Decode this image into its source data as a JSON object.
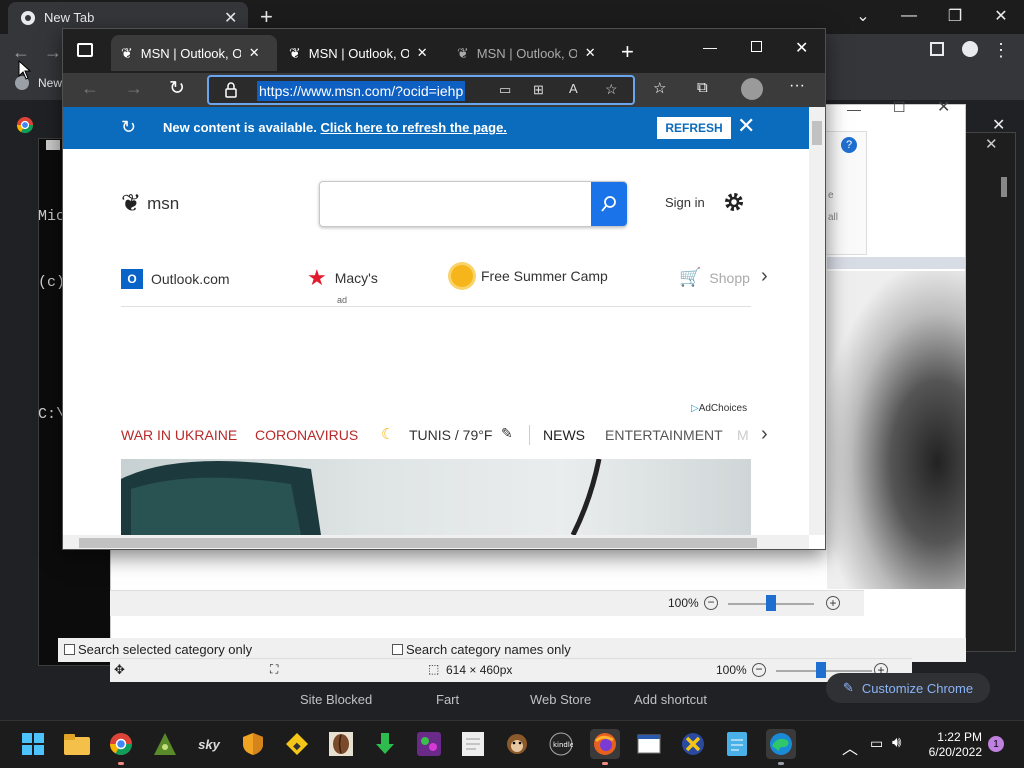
{
  "chrome": {
    "tab_title": "New Tab",
    "bookmark_label": "New",
    "shortcuts": [
      "Site Blocked",
      "Fart",
      "Web Store",
      "Add shortcut"
    ],
    "customize_label": "Customize Chrome"
  },
  "cmd": {
    "lines": [
      "Mic",
      "(c)",
      "",
      "C:\\"
    ]
  },
  "viewer": {
    "zoom": "100%",
    "zoom_bottom": "100%",
    "dimensions": "614 × 460px",
    "sidebar_partial": [
      "e",
      "all"
    ]
  },
  "categories": {
    "selected_only": "Search selected category only",
    "names_only": "Search category names only"
  },
  "edge": {
    "tabs": [
      {
        "title": "MSN | Outlook, Office"
      },
      {
        "title": "MSN | Outlook, Office"
      },
      {
        "title": "MSN | Outlook, Office"
      }
    ],
    "url": "https://www.msn.com/?ocid=iehp",
    "notice": {
      "text": "New content is available.",
      "link": "Click here to refresh the page.",
      "button": "REFRESH"
    },
    "msn": {
      "logo_text": "msn",
      "signin": "Sign in",
      "quicklinks": [
        {
          "label": "Outlook.com",
          "icon": "outlook-icon"
        },
        {
          "label": "Macy's",
          "icon": "macys-icon",
          "badge": "ad"
        },
        {
          "label": "Free Summer Camp",
          "icon": "sun-icon"
        },
        {
          "label": "Shopp",
          "icon": "cart-icon"
        }
      ],
      "adchoices": "AdChoices",
      "nav": {
        "war": "WAR IN UKRAINE",
        "corona": "CORONAVIRUS",
        "weather": "TUNIS / 79°F",
        "news": "NEWS",
        "entertainment": "ENTERTAINMENT",
        "more": "M"
      }
    }
  },
  "taskbar": {
    "time": "1:22 PM",
    "date": "6/20/2022",
    "notifications": "1"
  }
}
